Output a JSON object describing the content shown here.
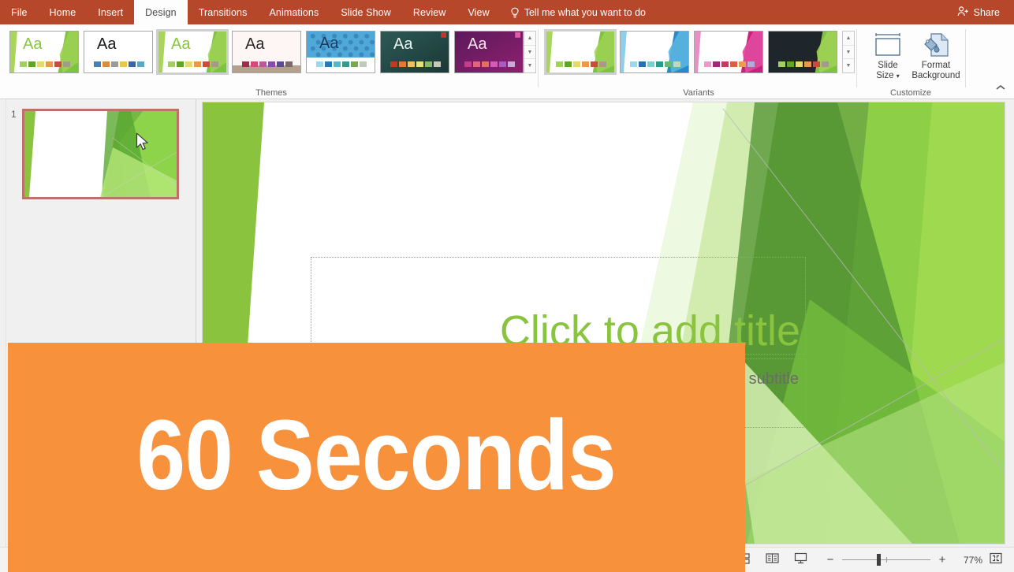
{
  "app": {
    "accent_color": "#b7472a",
    "theme_green": "#8ac43f",
    "overlay_color": "#f7913c"
  },
  "ribbon_tabs": [
    {
      "label": "File",
      "active": false
    },
    {
      "label": "Home",
      "active": false
    },
    {
      "label": "Insert",
      "active": false
    },
    {
      "label": "Design",
      "active": true
    },
    {
      "label": "Transitions",
      "active": false
    },
    {
      "label": "Animations",
      "active": false
    },
    {
      "label": "Slide Show",
      "active": false
    },
    {
      "label": "Review",
      "active": false
    },
    {
      "label": "View",
      "active": false
    }
  ],
  "tell_me": {
    "label": "Tell me what you want to do",
    "icon": "lightbulb-icon"
  },
  "share": {
    "label": "Share",
    "icon": "share-person-icon"
  },
  "themes_group": {
    "label": "Themes",
    "scroll_up_icon": "scroll-up-icon",
    "scroll_down_icon": "scroll-down-icon",
    "more_icon": "more-themes-icon",
    "items": [
      {
        "name": "facet-green-theme",
        "aa": "Aa",
        "selected": false
      },
      {
        "name": "office-theme",
        "aa": "Aa",
        "selected": false
      },
      {
        "name": "facet-theme",
        "aa": "Aa",
        "selected": true
      },
      {
        "name": "wisp-theme",
        "aa": "Aa",
        "selected": false
      },
      {
        "name": "berlin-theme",
        "aa": "Aa",
        "selected": false
      },
      {
        "name": "quotable-theme",
        "aa": "Aa",
        "selected": false
      },
      {
        "name": "ion-boardroom-theme",
        "aa": "Aa",
        "selected": false
      }
    ]
  },
  "variants_group": {
    "label": "Variants",
    "scroll_up_icon": "scroll-up-icon",
    "scroll_down_icon": "scroll-down-icon",
    "more_icon": "more-variants-icon",
    "items": [
      {
        "name": "variant-green",
        "selected": true
      },
      {
        "name": "variant-blue",
        "selected": false
      },
      {
        "name": "variant-magenta",
        "selected": false
      },
      {
        "name": "variant-dark",
        "selected": false
      }
    ]
  },
  "customize_group": {
    "label": "Customize",
    "slide_size": {
      "line1": "Slide",
      "line2": "Size",
      "icon": "slide-size-icon",
      "has_dropdown": true
    },
    "format_background": {
      "line1": "Format",
      "line2": "Background",
      "icon": "format-background-icon"
    }
  },
  "ribbon_collapse": {
    "icon": "chevron-up-icon"
  },
  "slide_panel": {
    "slides": [
      {
        "number": "1",
        "selected": true
      }
    ]
  },
  "slide": {
    "title_placeholder": "Click to add title",
    "subtitle_placeholder": "Click to add subtitle"
  },
  "overlay": {
    "text": "60 Seconds"
  },
  "status_bar": {
    "views": [
      {
        "name": "normal-view-button",
        "icon": "normal-view-icon",
        "active": true
      },
      {
        "name": "slide-sorter-button",
        "icon": "slide-sorter-icon",
        "active": false
      },
      {
        "name": "reading-view-button",
        "icon": "reading-view-icon",
        "active": false
      },
      {
        "name": "slide-show-button",
        "icon": "slide-show-icon",
        "active": false
      }
    ],
    "zoom_out_label": "−",
    "zoom_in_label": "+",
    "zoom_percent": "77%",
    "fit_window_icon": "fit-to-window-icon"
  }
}
